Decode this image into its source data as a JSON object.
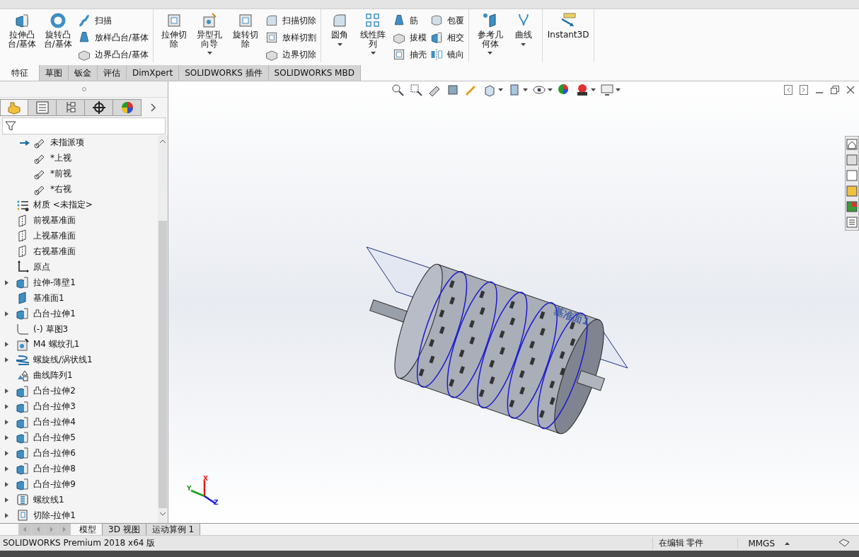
{
  "ribbon": {
    "groups": [
      {
        "tools": [
          {
            "kind": "large",
            "label": "拉伸凸台/基体",
            "dropdown": false
          },
          {
            "kind": "large",
            "label": "旋转凸台/基体",
            "dropdown": false
          },
          {
            "kind": "stack",
            "items": [
              "扫描",
              "放样凸台/基体",
              "边界凸台/基体"
            ]
          }
        ]
      },
      {
        "tools": [
          {
            "kind": "large",
            "label": "拉伸切除",
            "dropdown": false
          },
          {
            "kind": "large",
            "label": "异型孔向导",
            "dropdown": true
          },
          {
            "kind": "large",
            "label": "旋转切除",
            "dropdown": false
          },
          {
            "kind": "stack",
            "items": [
              "扫描切除",
              "放样切割",
              "边界切除"
            ]
          }
        ]
      },
      {
        "tools": [
          {
            "kind": "large",
            "label": "圆角",
            "dropdown": true
          },
          {
            "kind": "large",
            "label": "线性阵列",
            "dropdown": true
          },
          {
            "kind": "stack",
            "items": [
              "筋",
              "拔模",
              "抽壳"
            ]
          },
          {
            "kind": "stack",
            "items": [
              "包覆",
              "相交",
              "镜向"
            ]
          }
        ]
      },
      {
        "tools": [
          {
            "kind": "large",
            "label": "参考几何体",
            "dropdown": true
          },
          {
            "kind": "large",
            "label": "曲线",
            "dropdown": true
          }
        ]
      },
      {
        "tools": [
          {
            "kind": "large",
            "label": "Instant3D",
            "dropdown": false
          }
        ]
      }
    ]
  },
  "command_tabs": [
    {
      "label": "特征",
      "selected": true
    },
    {
      "label": "草图",
      "selected": false
    },
    {
      "label": "钣金",
      "selected": false
    },
    {
      "label": "评估",
      "selected": false
    },
    {
      "label": "DimXpert",
      "selected": false
    },
    {
      "label": "SOLIDWORKS 插件",
      "selected": false
    },
    {
      "label": "SOLIDWORKS MBD",
      "selected": false
    }
  ],
  "panel_tabs": [
    {
      "kind": "feature",
      "selected": true
    },
    {
      "kind": "property",
      "selected": false
    },
    {
      "kind": "config",
      "selected": false
    },
    {
      "kind": "dimxpert",
      "selected": false
    },
    {
      "kind": "display",
      "selected": false
    }
  ],
  "feature_tree": {
    "visible_children": [
      {
        "kind": "view",
        "label": "未指派项",
        "current": true
      },
      {
        "kind": "view",
        "label": "*上视",
        "current": false
      },
      {
        "kind": "view",
        "label": "*前视",
        "current": false
      },
      {
        "kind": "view",
        "label": "*右视",
        "current": false
      }
    ],
    "items": [
      {
        "kind": "material",
        "label": "材质 <未指定>",
        "expandable": false
      },
      {
        "kind": "plane",
        "label": "前视基准面",
        "expandable": false
      },
      {
        "kind": "plane",
        "label": "上视基准面",
        "expandable": false
      },
      {
        "kind": "plane",
        "label": "右视基准面",
        "expandable": false
      },
      {
        "kind": "origin",
        "label": "原点",
        "expandable": false
      },
      {
        "kind": "extrude",
        "label": "拉伸-薄壁1",
        "expandable": true
      },
      {
        "kind": "solid-plane",
        "label": "基准面1",
        "expandable": false
      },
      {
        "kind": "extrude",
        "label": "凸台-拉伸1",
        "expandable": true
      },
      {
        "kind": "sketch",
        "label": "(-) 草图3",
        "expandable": false
      },
      {
        "kind": "hole",
        "label": "M4 螺纹孔1",
        "expandable": true
      },
      {
        "kind": "helix",
        "label": "螺旋线/涡状线1",
        "expandable": true
      },
      {
        "kind": "pattern",
        "label": "曲线阵列1",
        "expandable": false
      },
      {
        "kind": "extrude",
        "label": "凸台-拉伸2",
        "expandable": true
      },
      {
        "kind": "extrude",
        "label": "凸台-拉伸3",
        "expandable": true
      },
      {
        "kind": "extrude",
        "label": "凸台-拉伸4",
        "expandable": true
      },
      {
        "kind": "extrude",
        "label": "凸台-拉伸5",
        "expandable": true
      },
      {
        "kind": "extrude",
        "label": "凸台-拉伸6",
        "expandable": true
      },
      {
        "kind": "extrude",
        "label": "凸台-拉伸8",
        "expandable": true
      },
      {
        "kind": "extrude",
        "label": "凸台-拉伸9",
        "expandable": true
      },
      {
        "kind": "thread",
        "label": "螺纹线1",
        "expandable": true
      },
      {
        "kind": "cut",
        "label": "切除-拉伸1",
        "expandable": true
      }
    ]
  },
  "viewport": {
    "plane_label": "基准面1",
    "triad": [
      {
        "label": "X",
        "color": "#e01818"
      },
      {
        "label": "Y",
        "color": "#1a9a1a"
      },
      {
        "label": "Z",
        "color": "#1818d8"
      }
    ]
  },
  "bottom_tabs": [
    {
      "label": "模型",
      "selected": true
    },
    {
      "label": "3D 视图",
      "selected": false
    },
    {
      "label": "运动算例 1",
      "selected": false
    }
  ],
  "status_bar": {
    "app": "SOLIDWORKS Premium 2018 x64 版",
    "mode": "在编辑 零件",
    "units": "MMGS"
  }
}
